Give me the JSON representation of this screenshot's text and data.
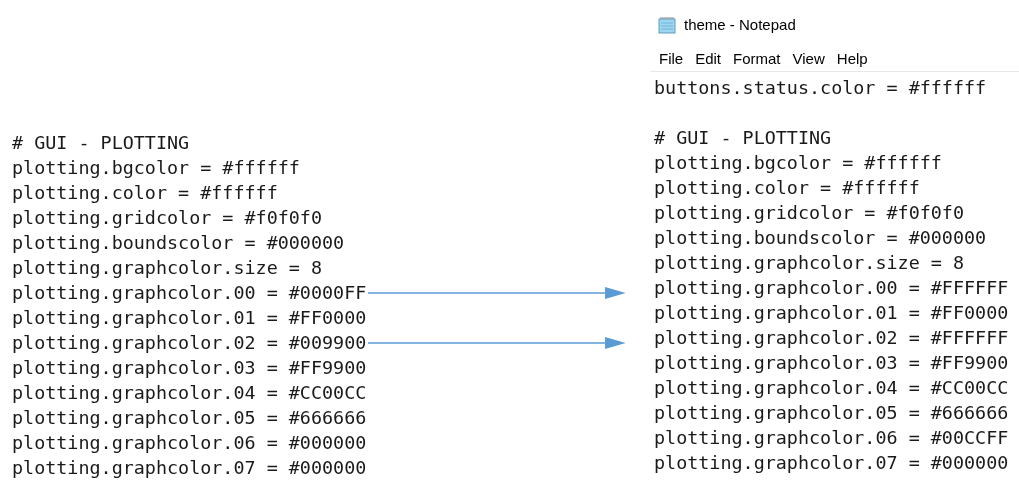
{
  "left_listing": {
    "lines": [
      {
        "text": "# GUI - PLOTTING",
        "arrow": false
      },
      {
        "text": "plotting.bgcolor = #ffffff",
        "arrow": false
      },
      {
        "text": "plotting.color = #ffffff",
        "arrow": false
      },
      {
        "text": "plotting.gridcolor = #f0f0f0",
        "arrow": false
      },
      {
        "text": "plotting.boundscolor = #000000",
        "arrow": false
      },
      {
        "text": "plotting.graphcolor.size = 8",
        "arrow": false
      },
      {
        "text": "plotting.graphcolor.00 = #0000FF",
        "arrow": true
      },
      {
        "text": "plotting.graphcolor.01 = #FF0000",
        "arrow": false
      },
      {
        "text": "plotting.graphcolor.02 = #009900",
        "arrow": true
      },
      {
        "text": "plotting.graphcolor.03 = #FF9900",
        "arrow": false
      },
      {
        "text": "plotting.graphcolor.04 = #CC00CC",
        "arrow": false
      },
      {
        "text": "plotting.graphcolor.05 = #666666",
        "arrow": false
      },
      {
        "text": "plotting.graphcolor.06 = #000000",
        "arrow": false
      },
      {
        "text": "plotting.graphcolor.07 = #000000",
        "arrow": false
      }
    ]
  },
  "notepad": {
    "title": "theme - Notepad",
    "menu": [
      "File",
      "Edit",
      "Format",
      "View",
      "Help"
    ],
    "paragraphs": [
      [
        "buttons.status.color = #ffffff"
      ],
      [
        "# GUI - PLOTTING",
        "plotting.bgcolor = #ffffff",
        "plotting.color = #ffffff",
        "plotting.gridcolor = #f0f0f0",
        "plotting.boundscolor = #000000",
        "plotting.graphcolor.size = 8",
        "plotting.graphcolor.00 = #FFFFFF",
        "plotting.graphcolor.01 = #FF0000",
        "plotting.graphcolor.02 = #FFFFFF",
        "plotting.graphcolor.03 = #FF9900",
        "plotting.graphcolor.04 = #CC00CC",
        "plotting.graphcolor.05 = #666666",
        "plotting.graphcolor.06 = #00CCFF",
        "plotting.graphcolor.07 = #000000"
      ]
    ]
  }
}
